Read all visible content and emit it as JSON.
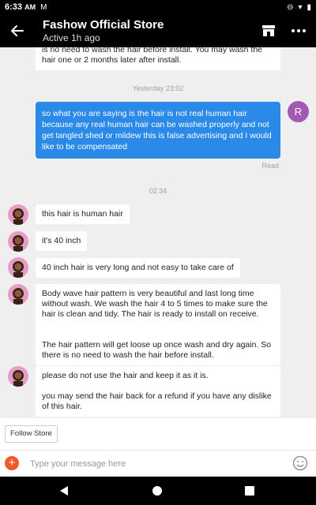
{
  "status_bar": {
    "time": "6:33",
    "ampm": "AM",
    "mail_icon": "gmail-icon"
  },
  "header": {
    "store_name": "Fashow Official Store",
    "active_status": "Active 1h ago"
  },
  "chat": {
    "top_partial": "is no need to wash the hair before install. You may wash the hair one or 2 months later after install.",
    "timestamp_1": "Yesterday 23:02",
    "user_initial": "R",
    "user_message": "so what you are saying is the hair is not real human hair because any real human hair can be washed properly and not get tangled shed or mildew this is false advertising and I would like to be compensated",
    "read_label": "Read",
    "timestamp_2": "02:34",
    "replies": [
      "this hair is human hair",
      "it's 40 inch",
      "40 inch hair is very long and not easy to take care of",
      "Body wave hair pattern is very beautiful and last long time without wash.    We wash the hair 4 to 5 times to make sure the hair is clean and tidy. The hair is ready to install on receive.\n\n\nThe hair pattern will get loose up once wash and dry again. So there is no need to wash the hair before install.",
      "please do not use the hair and keep it as it is.\n\nyou may send the hair back for a refund if you have any dislike of this hair."
    ]
  },
  "follow_button": "Follow Store",
  "input": {
    "placeholder": "Type your message here"
  },
  "colors": {
    "accent_blue": "#2b8ae8",
    "plus_orange": "#f05a28",
    "avatar_purple": "#a259b4"
  }
}
